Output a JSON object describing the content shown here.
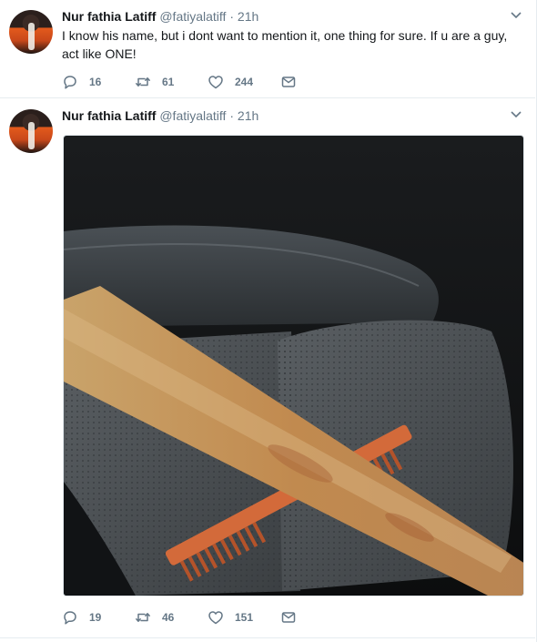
{
  "tweets": [
    {
      "author_name": "Nur fathia Latiff",
      "handle": "@fatiyalatiff",
      "separator": "·",
      "time": "21h",
      "text": "I know his name, but i dont want to mention it, one thing for sure. If u are a guy, act like ONE!",
      "reply_count": "16",
      "retweet_count": "61",
      "like_count": "244"
    },
    {
      "author_name": "Nur fathia Latiff",
      "handle": "@fatiyalatiff",
      "separator": "·",
      "time": "21h",
      "reply_count": "19",
      "retweet_count": "46",
      "like_count": "151"
    }
  ],
  "icons": {
    "reply": "reply-icon",
    "retweet": "retweet-icon",
    "like": "heart-icon",
    "message": "envelope-icon",
    "more": "chevron-down-icon"
  },
  "colors": {
    "name": "#14171a",
    "secondary": "#657786",
    "divider": "#e6ecf0"
  }
}
